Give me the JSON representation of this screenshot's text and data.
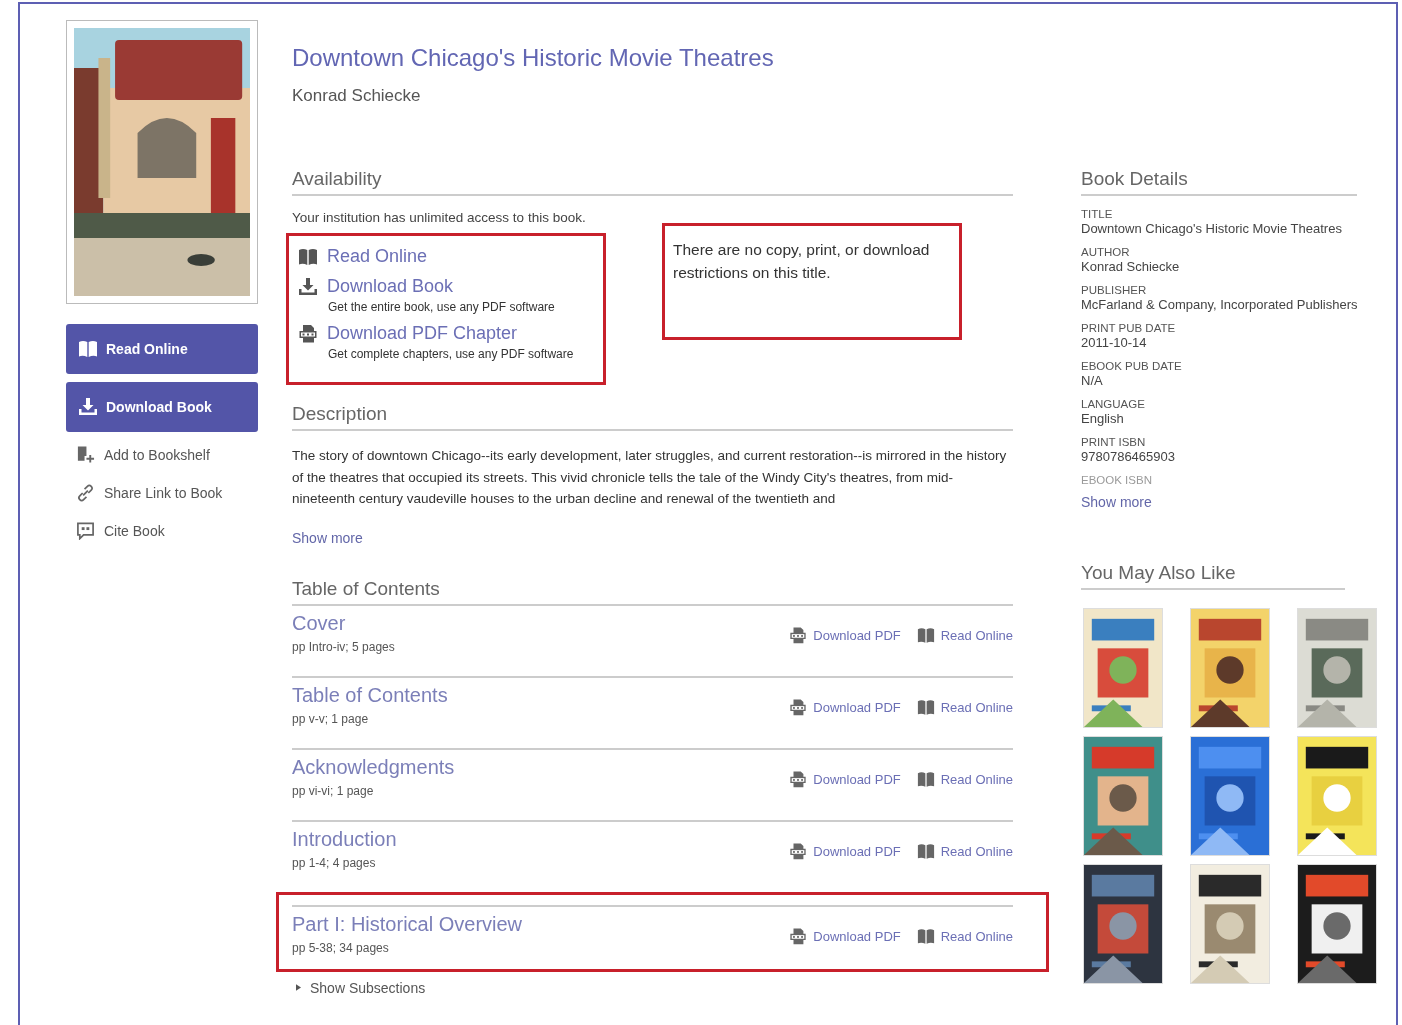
{
  "book": {
    "title": "Downtown Chicago's Historic Movie Theatres",
    "author": "Konrad Schiecke"
  },
  "sidebar": {
    "buttons": [
      {
        "kind": "read",
        "label": "Read Online"
      },
      {
        "kind": "download",
        "label": "Download Book"
      }
    ],
    "links": [
      {
        "kind": "bookshelf",
        "label": "Add to Bookshelf"
      },
      {
        "kind": "share",
        "label": "Share Link to Book"
      },
      {
        "kind": "cite",
        "label": "Cite Book"
      }
    ]
  },
  "availability": {
    "heading": "Availability",
    "access": "Your institution has unlimited access to this book.",
    "options_highlighted": true,
    "options": [
      {
        "kind": "read",
        "label": "Read Online"
      },
      {
        "kind": "download",
        "label": "Download Book",
        "note": "Get the entire book, use any PDF software"
      },
      {
        "kind": "pdf",
        "label": "Download PDF Chapter",
        "note": "Get complete chapters, use any PDF software"
      }
    ],
    "restrictions": {
      "text": "There are no copy, print, or download restrictions on this title.",
      "highlighted": true
    }
  },
  "description": {
    "heading": "Description",
    "text": "The story of downtown Chicago--its early development, later struggles, and current restoration--is mirrored in the history of the theatres that occupied its streets. This vivid chronicle tells the tale of the Windy City's theatres, from mid-nineteenth century vaudeville houses to the urban decline and renewal of the twentieth and",
    "show_more": "Show more"
  },
  "table_of_contents": {
    "heading": "Table of Contents",
    "rows": [
      {
        "title": "Cover",
        "pages": "pp Intro-iv; 5 pages",
        "highlighted": false,
        "actions": [
          "Download PDF",
          "Read Online"
        ]
      },
      {
        "title": "Table of Contents",
        "pages": "pp v-v; 1 page",
        "highlighted": false,
        "actions": [
          "Download PDF",
          "Read Online"
        ]
      },
      {
        "title": "Acknowledgments",
        "pages": "pp vi-vi; 1 page",
        "highlighted": false,
        "actions": [
          "Download PDF",
          "Read Online"
        ]
      },
      {
        "title": "Introduction",
        "pages": "pp 1-4; 4 pages",
        "highlighted": false,
        "actions": [
          "Download PDF",
          "Read Online"
        ]
      },
      {
        "title": "Part I: Historical Overview",
        "pages": "pp 5-38; 34 pages",
        "highlighted": true,
        "actions": [
          "Download PDF",
          "Read Online"
        ]
      }
    ],
    "show_subsections": "Show Subsections"
  },
  "book_details": {
    "heading": "Book Details",
    "fields": [
      {
        "label": "TITLE",
        "value": "Downtown Chicago's Historic Movie Theatres",
        "faded": false
      },
      {
        "label": "AUTHOR",
        "value": "Konrad Schiecke",
        "faded": false
      },
      {
        "label": "PUBLISHER",
        "value": "McFarland & Company, Incorporated Publishers",
        "faded": false
      },
      {
        "label": "PRINT PUB DATE",
        "value": "2011-10-14",
        "faded": false
      },
      {
        "label": "EBOOK PUB DATE",
        "value": "N/A",
        "faded": false
      },
      {
        "label": "LANGUAGE",
        "value": "English",
        "faded": false
      },
      {
        "label": "PRINT ISBN",
        "value": "9780786465903",
        "faded": false
      },
      {
        "label": "EBOOK ISBN",
        "faded": true
      }
    ],
    "show_more": "Show more"
  },
  "you_may_also_like": {
    "heading": "You May Also Like"
  }
}
